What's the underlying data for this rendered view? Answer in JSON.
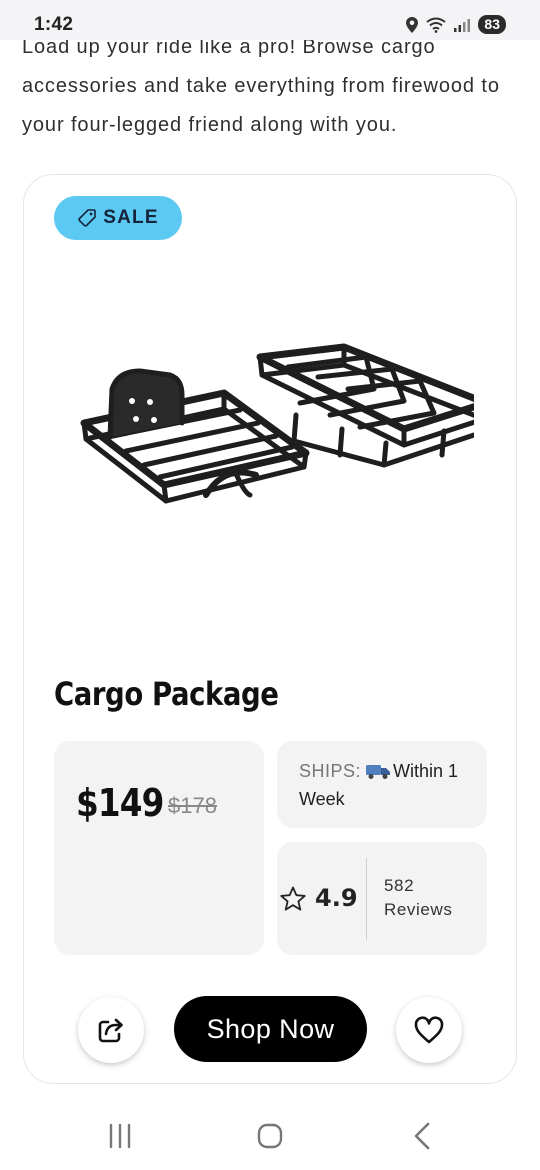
{
  "status_bar": {
    "time": "1:42",
    "battery": "83"
  },
  "intro": {
    "text": "Load up your ride like a pro! Browse cargo accessories and take everything from firewood to your four-legged friend along with you."
  },
  "product": {
    "badge": "SALE",
    "image_icon": "cargo-baskets-image",
    "title": "Cargo Package",
    "price": "$149",
    "old_price": "$178",
    "ships_label": "SHIPS:",
    "ships_value": "Within 1 Week",
    "rating": "4.9",
    "reviews_count": "582",
    "reviews_label": "Reviews"
  },
  "actions": {
    "shop_label": "Shop Now",
    "share_icon": "share-icon",
    "favorite_icon": "heart-icon"
  },
  "nav": {
    "recents_icon": "recents-icon",
    "home_icon": "home-icon",
    "back_icon": "back-icon"
  },
  "colors": {
    "sale_badge": "#5bc9f2",
    "shop_button": "#000000",
    "tile_bg": "#f3f3f3"
  }
}
